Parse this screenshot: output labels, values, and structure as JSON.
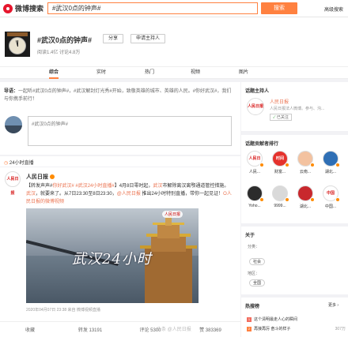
{
  "topbar": {
    "logo_text": "微博搜索",
    "search_value": "#武汉0点的钟声#",
    "search_button": "搜索",
    "advanced_search": "高级搜索"
  },
  "topic": {
    "title": "#武汉0点的钟声#",
    "share_label": "分享",
    "apply_host_label": "申请主持人",
    "stats": "阅读1.4亿   讨论4.8万"
  },
  "tabs": [
    {
      "label": "综合",
      "active": true
    },
    {
      "label": "实时",
      "active": false
    },
    {
      "label": "热门",
      "active": false
    },
    {
      "label": "视频",
      "active": false
    },
    {
      "label": "图片",
      "active": false
    }
  ],
  "guide": {
    "label": "导语：",
    "text": "一起听#武汉0点的钟声#，#武汉解封灯光秀#开始，致敬英雄的城市、英雄的人民。#你好武汉#，我们与你携手前行！"
  },
  "composer": {
    "placeholder": "#武汉0点的钟声#"
  },
  "section_24h": {
    "label": "24小时直播"
  },
  "post": {
    "author": "人民日报",
    "avatar_text": "人民日报",
    "text_prefix": "【转发声声#",
    "text_link1": "你好武汉#",
    "text_mid1": " ",
    "text_link2": "#武汉24小时直播#",
    "text_mid2": "】4月8日零时起，",
    "text_link3": "武汉",
    "text_mid3": "市解除离汉离鄂通道管控措施。",
    "text_link4": "武汉",
    "text_mid4": "，就要来了。从7日23:30至8日23:30，",
    "text_link5": "@人民日报",
    "text_mid5": " 推出24小时特别直播，带你一起见证！",
    "text_link6": "O人民日报的微博视频",
    "image_caption": "武汉24小时",
    "image_badge": "人民日报",
    "meta": "2020年04月07日 23:38  来自 微博视频直播",
    "actions": {
      "favorite": "收藏",
      "repost": "转发 13191",
      "comment": "评论 5300",
      "like": "赞 383369"
    }
  },
  "sidebar": {
    "host": {
      "title": "话题主持人",
      "name": "人民日报",
      "avatar_text": "人民日报",
      "desc": "人民日报法人微博。参与、沟...",
      "followed_label": "已关注"
    },
    "contributors": {
      "title": "话题贡献者排行",
      "items": [
        {
          "name": "人民...",
          "color": "#ffffff",
          "text": "人民日报"
        },
        {
          "name": "财富...",
          "color": "#e5322d",
          "text": "时间"
        },
        {
          "name": "云南...",
          "color": "#f3c2a0",
          "text": ""
        },
        {
          "name": "湖北...",
          "color": "#2f6fb5",
          "text": ""
        },
        {
          "name": "Yoho...",
          "color": "#2c2c2c",
          "text": ""
        },
        {
          "name": "9999...",
          "color": "#d9d9d9",
          "text": ""
        },
        {
          "name": "湖北...",
          "color": "#c8282d",
          "text": ""
        },
        {
          "name": "中国...",
          "color": "#ffffff",
          "text": "中国"
        }
      ]
    },
    "about": {
      "title": "关于",
      "category_label": "分类：",
      "category_value": "社会",
      "region_label": "地区：",
      "region_value": "全国"
    },
    "hot": {
      "title": "热搜榜",
      "more": "更多 ›",
      "items": [
        {
          "rank": "1",
          "text": "这个清明最走人心的瞬间",
          "count": "",
          "color": "#f26d5f"
        },
        {
          "rank": "2",
          "text": "再接再厉 奋斗的样子",
          "count": "307万",
          "color": "#ff8140"
        }
      ]
    }
  },
  "watermark": "头条 @人民日报"
}
